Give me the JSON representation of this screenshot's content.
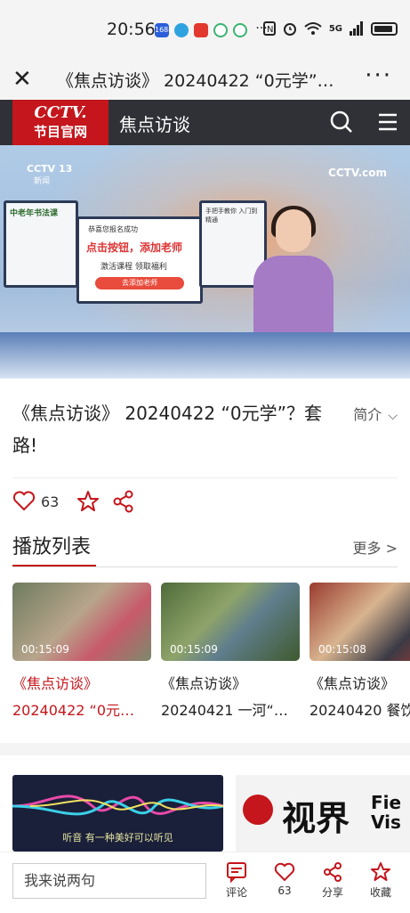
{
  "status_bar": {
    "time": "20:56",
    "app_icon_label": "1688",
    "network": "5G",
    "more": "···"
  },
  "title_bar": {
    "title": "《焦点访谈》 20240422 “0元学”…",
    "more": "···"
  },
  "cctv_header": {
    "logo_line1": "CCTV.",
    "logo_line2": "节目官网",
    "section": "焦点访谈"
  },
  "video": {
    "channel": "CCTV 13",
    "channel_sub": "新闻",
    "watermark": "CCTV.com",
    "screen_left_text": "中老年书法课",
    "screen_center_line1": "恭喜您报名成功",
    "screen_center_line2": "点击按钮，添加老师",
    "screen_center_line3": "激活课程  领取福利",
    "screen_center_button": "去添加老师",
    "screen_right_text": "手把手教你 入门到精通"
  },
  "program": {
    "title": "《焦点访谈》 20240422 “0元学”？套路!",
    "intro_label": "简介",
    "like_count": "63"
  },
  "playlist": {
    "heading": "播放列表",
    "more": "更多 >",
    "items": [
      {
        "duration": "00:15:09",
        "line1": "《焦点访谈》",
        "line2": "20240422 “0元…"
      },
      {
        "duration": "00:15:09",
        "line1": "《焦点访谈》",
        "line2": "20240421 一河“…"
      },
      {
        "duration": "00:15:08",
        "line1": "《焦点访谈》",
        "line2": "20240420 餐饮"
      }
    ]
  },
  "ads": {
    "ad1_caption": "听音  有一种美好可以听见",
    "ad2_brand": "视界",
    "ad2_eng1": "Fie",
    "ad2_eng2": "Vis"
  },
  "bottom_bar": {
    "comment_placeholder": "我来说两句",
    "comment_label": "评论",
    "like_count": "63",
    "share_label": "分享",
    "favorite_label": "收藏"
  },
  "colors": {
    "brand_red": "#c4161c",
    "header_dark": "#2f3136"
  }
}
